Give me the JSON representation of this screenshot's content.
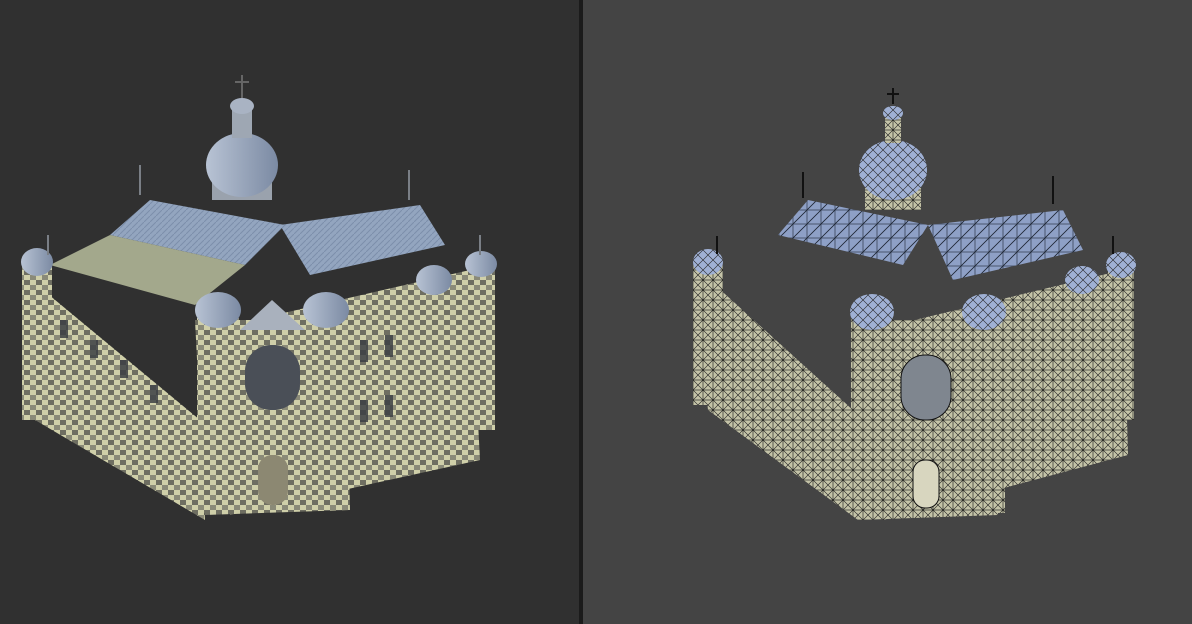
{
  "scene": {
    "left_view": {
      "mode": "shaded",
      "background": "#303030"
    },
    "right_view": {
      "mode": "wireframe-over-shaded",
      "background": "#444444"
    },
    "colors": {
      "stone": "#c9c8a4",
      "stone_dark": "#6f6f62",
      "roof": "#8fa2bd",
      "roof_dark": "#5d6e86",
      "dome": "#9aa8bf",
      "wire": "#111111"
    }
  }
}
